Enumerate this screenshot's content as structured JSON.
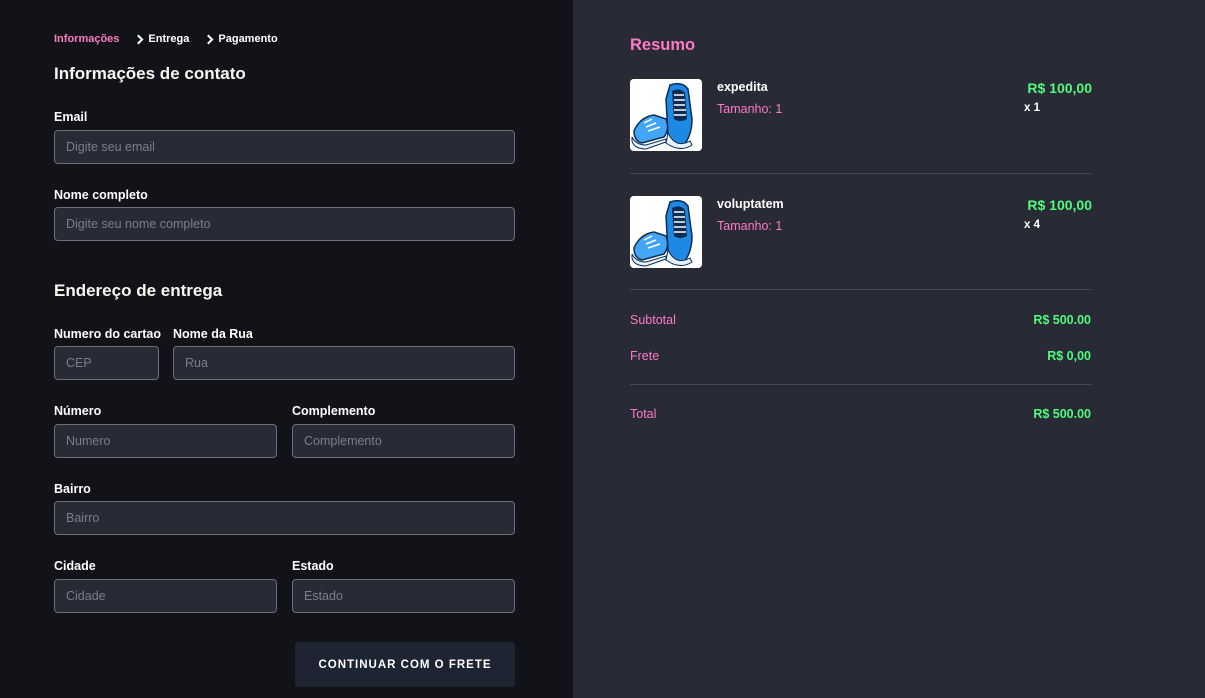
{
  "breadcrumb": {
    "step1": "Informações",
    "step2": "Entrega",
    "step3": "Pagamento"
  },
  "contact": {
    "title": "Informações de contato",
    "email_label": "Email",
    "email_placeholder": "Digite seu email",
    "name_label": "Nome completo",
    "name_placeholder": "Digite seu nome completo"
  },
  "address": {
    "title": "Endereço de entrega",
    "card_label": "Numero do cartao",
    "cep_placeholder": "CEP",
    "street_label": "Nome da Rua",
    "street_placeholder": "Rua",
    "number_label": "Número",
    "number_placeholder": "Numero",
    "complement_label": "Complemento",
    "complement_placeholder": "Complemento",
    "district_label": "Bairro",
    "district_placeholder": "Bairro",
    "city_label": "Cidade",
    "city_placeholder": "Cidade",
    "state_label": "Estado",
    "state_placeholder": "Estado"
  },
  "continue_button": "CONTINUAR COM O FRETE",
  "summary": {
    "title": "Resumo",
    "items": [
      {
        "name": "expedita",
        "size": "Tamanho: 1",
        "price": "R$ 100,00",
        "qty": "x 1",
        "icon": "sneaker-image"
      },
      {
        "name": "voluptatem",
        "size": "Tamanho: 1",
        "price": "R$ 100,00",
        "qty": "x 4",
        "icon": "sneaker-image"
      }
    ],
    "subtotal_label": "Subtotal",
    "subtotal_value": "R$ 500.00",
    "shipping_label": "Frete",
    "shipping_value": "R$ 0,00",
    "total_label": "Total",
    "total_value": "R$ 500.00"
  },
  "colors": {
    "accent_pink": "#ff79c6",
    "price_green": "#50fa7b",
    "left_bg": "#111318",
    "right_bg": "#282a36"
  }
}
